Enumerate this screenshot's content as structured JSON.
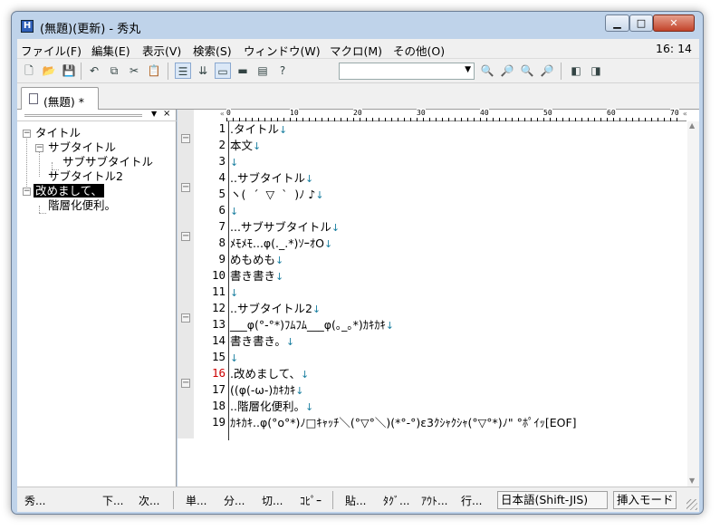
{
  "window": {
    "title": "(無題)(更新) - 秀丸",
    "app_icon": "H"
  },
  "menus": [
    "ファイル(F)",
    "編集(E)",
    "表示(V)",
    "検索(S)",
    "ウィンドウ(W)",
    "マクロ(M)",
    "その他(O)"
  ],
  "clock": "16: 14",
  "tabs": [
    {
      "label": "(無題) *"
    }
  ],
  "outline": {
    "nodes": [
      {
        "label": "タイトル",
        "level": 0,
        "expander": "−"
      },
      {
        "label": "サブタイトル",
        "level": 1,
        "expander": "−"
      },
      {
        "label": "サブサブタイトル",
        "level": 2
      },
      {
        "label": "サブタイトル2",
        "level": 1
      },
      {
        "label": "改めまして、",
        "level": 0,
        "expander": "−",
        "selected": true
      },
      {
        "label": "階層化便利。",
        "level": 1
      }
    ]
  },
  "ruler": {
    "marks": [
      "0",
      "10",
      "20",
      "30",
      "40",
      "50",
      "60",
      "70"
    ]
  },
  "editor": {
    "current_line": 16,
    "lines": [
      {
        "n": "1",
        "text": ".タイトル",
        "mark": "↓",
        "fold": "−"
      },
      {
        "n": "2",
        "text": "本文",
        "mark": "↓"
      },
      {
        "n": "3",
        "text": "",
        "mark": "↓"
      },
      {
        "n": "4",
        "text": "..サブタイトル",
        "mark": "↓",
        "fold": "−"
      },
      {
        "n": "5",
        "text": "ヽ(  ´  ▽  `  )ﾉ ♪",
        "mark": "↓"
      },
      {
        "n": "6",
        "text": "",
        "mark": "↓"
      },
      {
        "n": "7",
        "text": "...サブサブタイトル",
        "mark": "↓",
        "fold": "−"
      },
      {
        "n": "8",
        "text": "ﾒﾓﾒﾓ...φ(._.*)ｿｰｵO",
        "mark": "↓"
      },
      {
        "n": "9",
        "text": "めもめも",
        "mark": "↓"
      },
      {
        "n": "10",
        "text": "書き書き",
        "mark": "↓"
      },
      {
        "n": "11",
        "text": "",
        "mark": "↓"
      },
      {
        "n": "12",
        "text": "..サブタイトル2",
        "mark": "↓",
        "fold": "−"
      },
      {
        "n": "13",
        "text": "___φ(°-°*)ﾌﾑﾌﾑ___φ(｡_｡*)ｶｷｶｷ",
        "mark": "↓"
      },
      {
        "n": "14",
        "text": "書き書き。",
        "mark": "↓"
      },
      {
        "n": "15",
        "text": "",
        "mark": "↓"
      },
      {
        "n": "16",
        "text": ".改めまして、",
        "mark": "↓",
        "fold": "−"
      },
      {
        "n": "17",
        "text": "((φ(-ω-)ｶｷｶｷ",
        "mark": "↓"
      },
      {
        "n": "18",
        "text": "..階層化便利。",
        "mark": "↓"
      },
      {
        "n": "19",
        "text": "ｶｷｶｷ..φ(°o°*)ﾉ□ｷｬｯﾁ＼(°▽°＼)(*°-°)ε3ｸｼｬｸｼｬ(°▽°*)ﾉ\" °ﾎﾟｲｯ[EOF]",
        "mark": ""
      }
    ]
  },
  "status": {
    "left": [
      "秀...",
      "下...",
      "次...",
      "単...",
      "分...",
      "切...",
      "ｺﾋﾟｰ",
      "貼...",
      "ﾀｸﾞ...",
      "ｱｳﾄ...",
      "行..."
    ],
    "encoding": "日本語(Shift-JIS)",
    "mode": "挿入モード"
  }
}
